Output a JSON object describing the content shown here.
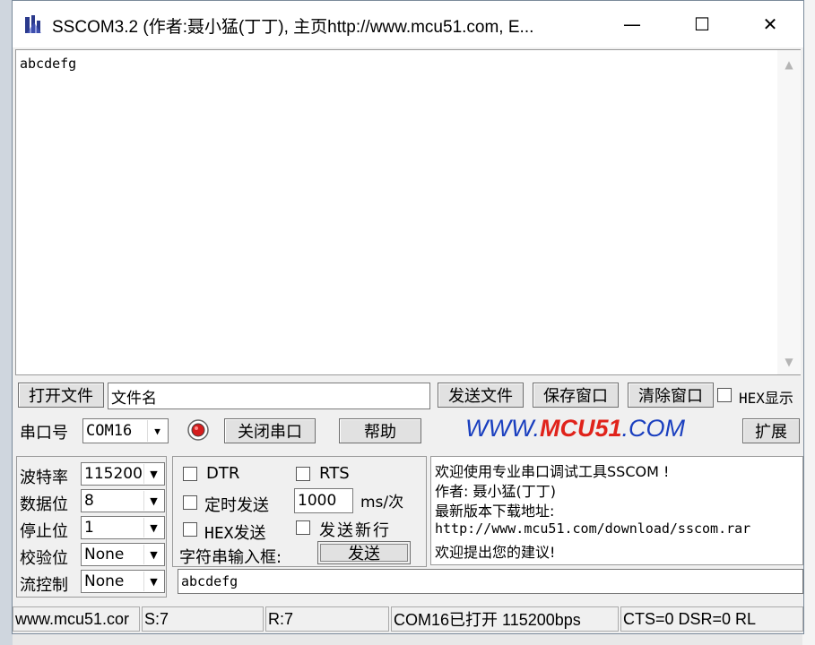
{
  "window": {
    "title": "SSCOM3.2 (作者:聂小猛(丁丁), 主页http://www.mcu51.com,  E...",
    "controls": {
      "minimize": "—",
      "maximize": "☐",
      "close": "✕"
    }
  },
  "receive_area": {
    "text": "abcdefg"
  },
  "file_row": {
    "open_file_label": "打开文件",
    "filename_value": "文件名",
    "send_file_label": "发送文件",
    "save_window_label": "保存窗口",
    "clear_window_label": "清除窗口",
    "hex_display_label": "HEX显示"
  },
  "port_row": {
    "port_label": "串口号",
    "port_value": "COM16",
    "close_port_label": "关闭串口",
    "help_label": "帮助",
    "logo_prefix": "WWW.",
    "logo_middle": "MCU51",
    "logo_suffix": ".COM",
    "expand_label": "扩展"
  },
  "settings": {
    "baud_label": "波特率",
    "baud_value": "115200",
    "databits_label": "数据位",
    "databits_value": "8",
    "stopbits_label": "停止位",
    "stopbits_value": "1",
    "parity_label": "校验位",
    "parity_value": "None",
    "flow_label": "流控制",
    "flow_value": "None"
  },
  "options": {
    "dtr_label": "DTR",
    "rts_label": "RTS",
    "timed_send_label": "定时发送",
    "interval_value": "1000",
    "interval_unit": "ms/次",
    "hex_send_label": "HEX发送",
    "newline_label": "发送新行",
    "input_box_label": "字符串输入框:",
    "send_label": "发送"
  },
  "info": {
    "line1": "欢迎使用专业串口调试工具SSCOM !",
    "line2": "作者: 聂小猛(丁丁)",
    "line3": "最新版本下载地址:",
    "line4": "http://www.mcu51.com/download/sscom.rar",
    "line5": "欢迎提出您的建议!"
  },
  "send_input": {
    "value": "abcdefg"
  },
  "statusbar": {
    "website": "www.mcu51.cor",
    "sent": "S:7",
    "received": "R:7",
    "port_status": "COM16已打开  115200bps",
    "lines": "CTS=0 DSR=0 RL"
  },
  "colors": {
    "logo_blue": "#1a3fbf",
    "logo_red": "#e0231b",
    "record_red": "#d41c1c"
  }
}
